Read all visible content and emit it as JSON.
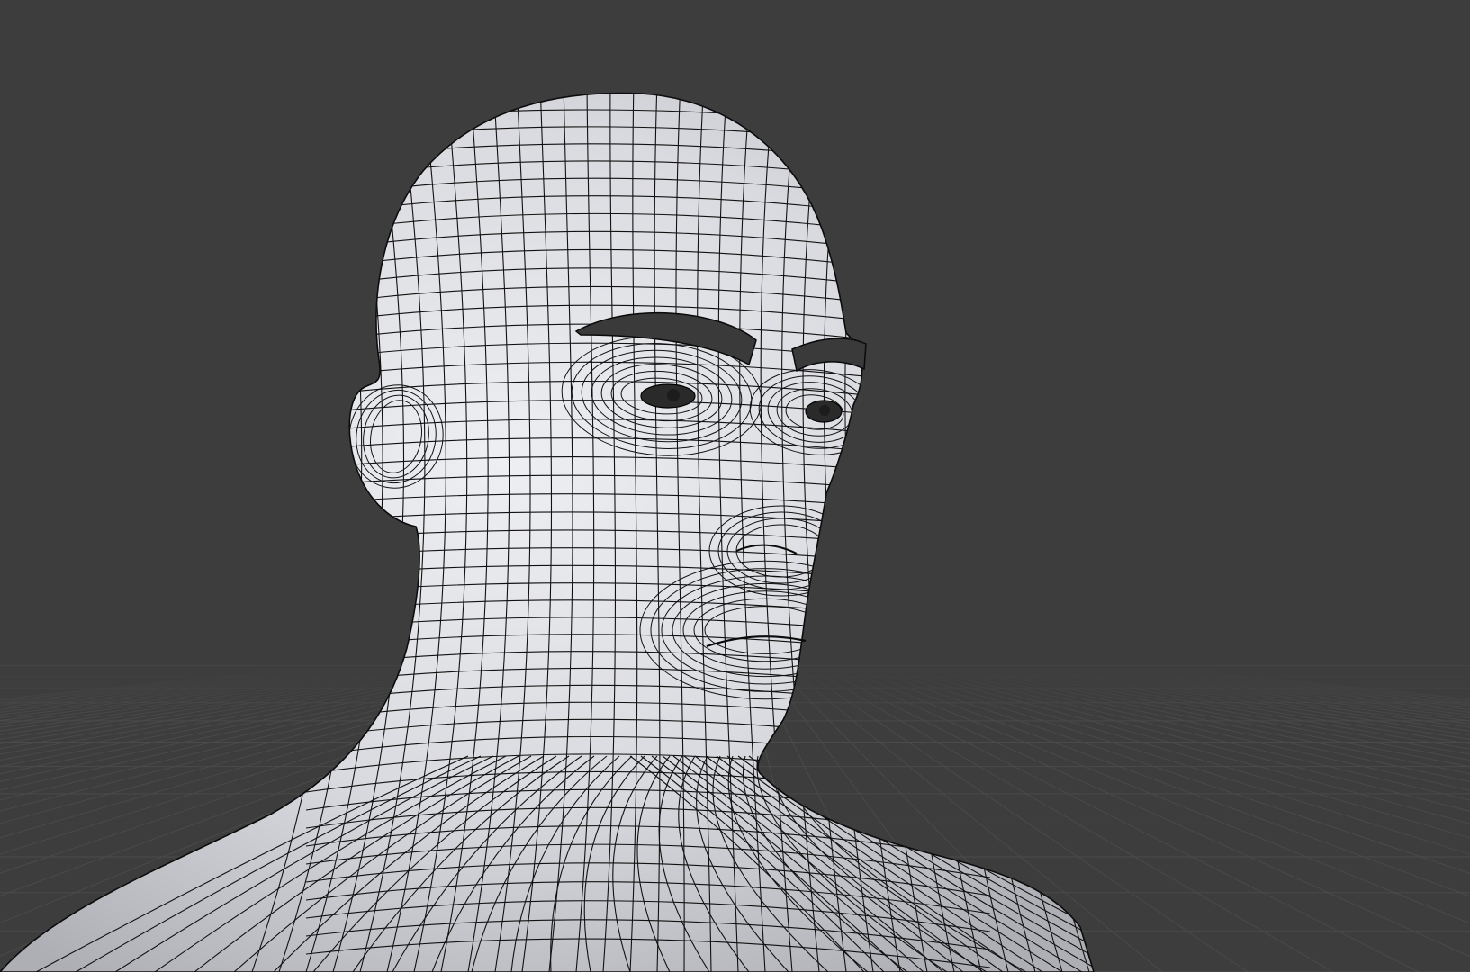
{
  "viewport": {
    "view": "3d-viewport",
    "shading": "solid",
    "overlay": "wireframe",
    "colors": {
      "background": "#3d3d3d",
      "grid_line": "#4a4a4a",
      "mesh_light": "#e4e5e9",
      "mesh_mid": "#c8c9ce",
      "mesh_shadow": "#a9aab0",
      "wire": "#111111",
      "brow": "#3a3a3a",
      "eye": "#1c1c1c"
    }
  },
  "scene": {
    "objects": [
      {
        "id": "head-mesh",
        "kind": "mesh"
      },
      {
        "id": "eyebrow-left",
        "kind": "mesh"
      },
      {
        "id": "eyebrow-right",
        "kind": "mesh"
      },
      {
        "id": "eye-left",
        "kind": "mesh"
      },
      {
        "id": "eye-right",
        "kind": "mesh"
      }
    ]
  }
}
